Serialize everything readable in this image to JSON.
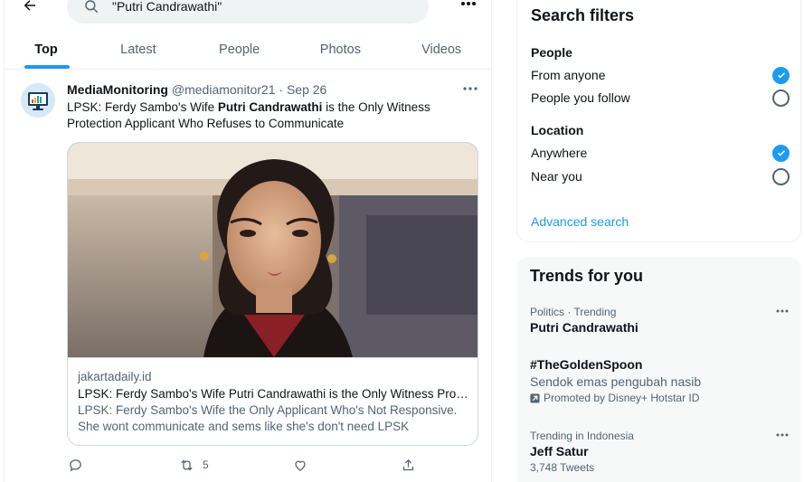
{
  "search": {
    "query": "\"Putri Candrawathi\""
  },
  "tabs": [
    {
      "label": "Top"
    },
    {
      "label": "Latest"
    },
    {
      "label": "People"
    },
    {
      "label": "Photos"
    },
    {
      "label": "Videos"
    }
  ],
  "tweet": {
    "name": "MediaMonitoring",
    "handle": "@mediamonitor21",
    "separator": "·",
    "date": "Sep 26",
    "text_before": "LPSK: Ferdy Sambo's Wife ",
    "text_bold": "Putri Candrawathi",
    "text_after": " is the Only Witness Protection Applicant Who Refuses to Communicate",
    "card": {
      "domain": "jakartadaily.id",
      "title": "LPSK: Ferdy Sambo's Wife Putri Candrawathi is the Only Witness Prot...",
      "description": "LPSK: Ferdy Sambo's Wife the Only Applicant Who's Not Responsive. She wont communicate and sems like she's don't need LPSK"
    },
    "retweet_count": "5"
  },
  "filters": {
    "title": "Search filters",
    "people": {
      "heading": "People",
      "options": [
        {
          "label": "From anyone",
          "selected": true
        },
        {
          "label": "People you follow",
          "selected": false
        }
      ]
    },
    "location": {
      "heading": "Location",
      "options": [
        {
          "label": "Anywhere",
          "selected": true
        },
        {
          "label": "Near you",
          "selected": false
        }
      ]
    },
    "advanced": "Advanced search"
  },
  "trends": {
    "title": "Trends for you",
    "items": [
      {
        "meta": "Politics · Trending",
        "title": "Putri Candrawathi"
      },
      {
        "title": "#TheGoldenSpoon",
        "sub": "Sendok emas pengubah nasib",
        "promo": "Promoted by Disney+ Hotstar ID"
      },
      {
        "meta": "Trending in Indonesia",
        "title": "Jeff Satur",
        "count": "3,748 Tweets"
      }
    ]
  },
  "colors": {
    "accent": "#1d9bf0",
    "text": "#0f1419",
    "muted": "#536471",
    "border": "#eff3f4"
  }
}
